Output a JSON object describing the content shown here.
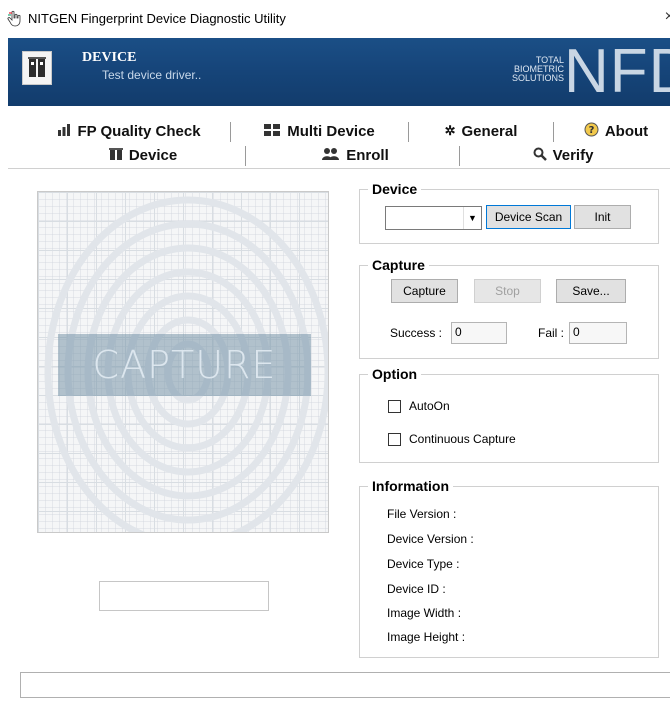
{
  "window": {
    "title": "NITGEN Fingerprint Device Diagnostic Utility",
    "close_glyph": "×"
  },
  "banner": {
    "title": "DEVICE",
    "subtitle": "Test device driver..",
    "brand_small_lines": [
      "TOTAL",
      "BIOMETRIC",
      "SOLUTIONS"
    ],
    "brand_big": "NFD",
    "colors": {
      "background": "#1b4f86",
      "text": "#ffffff"
    }
  },
  "tabs": {
    "row1": [
      {
        "label": "FP Quality Check",
        "icon": "bar-chart-icon"
      },
      {
        "label": "Multi Device",
        "icon": "multi-device-icon"
      },
      {
        "label": "General",
        "icon": "gear-icon"
      },
      {
        "label": "About",
        "icon": "help-icon"
      }
    ],
    "row2": [
      {
        "label": "Device",
        "icon": "device-icon",
        "active": true
      },
      {
        "label": "Enroll",
        "icon": "users-icon"
      },
      {
        "label": "Verify",
        "icon": "magnifier-icon"
      }
    ]
  },
  "capture": {
    "overlay_text": "CAPTURE"
  },
  "device_group": {
    "legend": "Device",
    "select_value": "",
    "scan_label": "Device Scan",
    "init_label": "Init"
  },
  "capture_group": {
    "legend": "Capture",
    "capture_label": "Capture",
    "stop_label": "Stop",
    "save_label": "Save...",
    "success_label": "Success :",
    "success_value": "0",
    "fail_label": "Fail :",
    "fail_value": "0"
  },
  "option_group": {
    "legend": "Option",
    "autoon_label": "AutoOn",
    "autoon_checked": false,
    "continuous_label": "Continuous Capture",
    "continuous_checked": false
  },
  "info_group": {
    "legend": "Information",
    "items": [
      "File Version :",
      "Device Version :",
      "Device Type :",
      "Device ID :",
      "Image Width :",
      "Image Height :"
    ]
  },
  "status": {
    "text": ""
  }
}
